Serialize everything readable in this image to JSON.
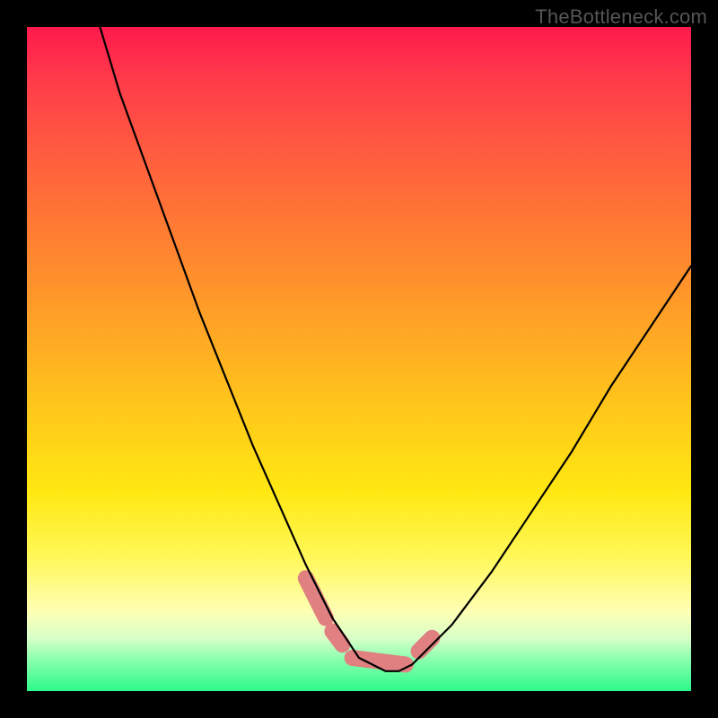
{
  "watermark": "TheBottleneck.com",
  "chart_data": {
    "type": "line",
    "title": "",
    "xlabel": "",
    "ylabel": "",
    "xlim": [
      0,
      100
    ],
    "ylim": [
      0,
      100
    ],
    "grid": false,
    "background": "rainbow-vertical-gradient",
    "series": [
      {
        "name": "bottleneck-curve",
        "x": [
          11,
          14,
          18,
          22,
          26,
          30,
          34,
          38,
          42,
          44,
          46,
          48,
          50,
          52,
          54,
          56,
          58,
          60,
          64,
          70,
          76,
          82,
          88,
          94,
          100
        ],
        "values": [
          100,
          90,
          79,
          68,
          57,
          47,
          37,
          28,
          19,
          15,
          11,
          8,
          5,
          4,
          3,
          3,
          4,
          6,
          10,
          18,
          27,
          36,
          46,
          55,
          64
        ]
      }
    ],
    "annotations": {
      "highlight_worm": {
        "color": "#e08080",
        "segments": [
          {
            "x": [
              42,
              45
            ],
            "values": [
              17,
              11
            ]
          },
          {
            "x": [
              46,
              47.5
            ],
            "values": [
              9,
              7
            ]
          },
          {
            "x": [
              49,
              57
            ],
            "values": [
              5,
              4
            ]
          },
          {
            "x": [
              59,
              61
            ],
            "values": [
              6,
              8
            ]
          }
        ]
      }
    }
  }
}
